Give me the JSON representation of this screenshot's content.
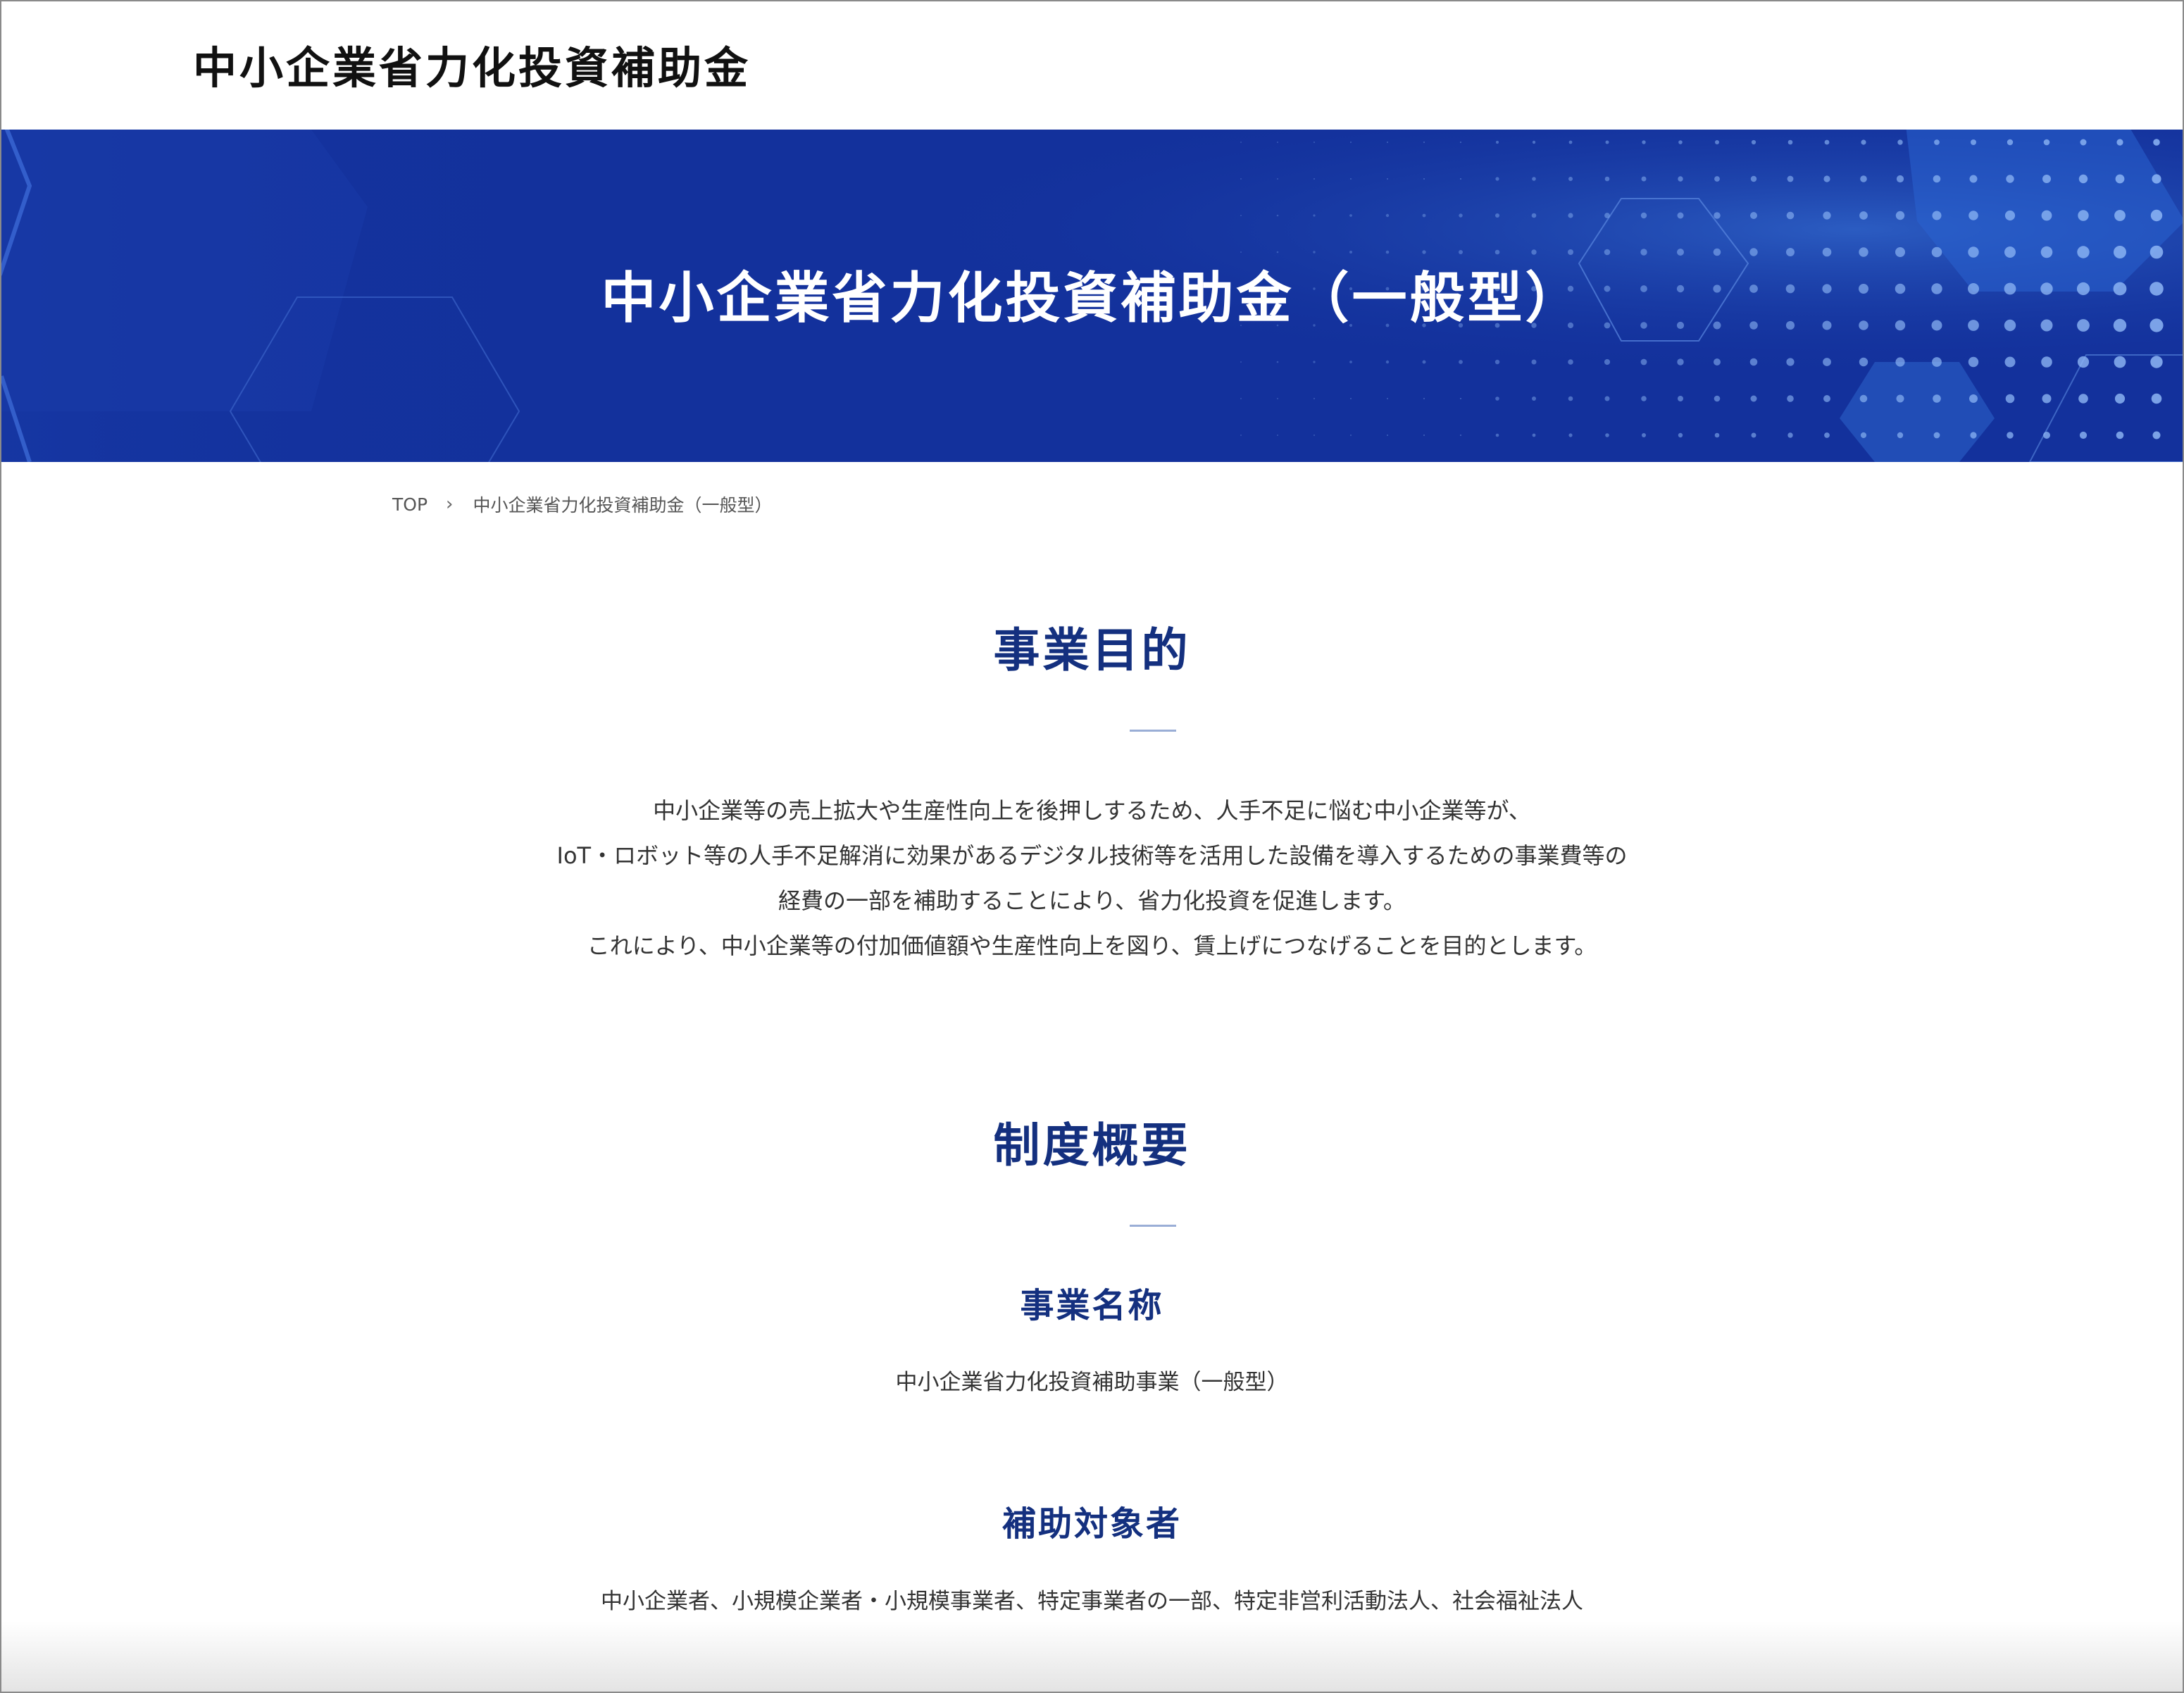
{
  "header": {
    "site_title": "中小企業省力化投資補助金"
  },
  "hero": {
    "title": "中小企業省力化投資補助金（一般型）"
  },
  "breadcrumb": {
    "home": "TOP",
    "separator": "›",
    "current": "中小企業省力化投資補助金（一般型）"
  },
  "purpose": {
    "title": "事業目的",
    "lines": [
      "中小企業等の売上拡大や生産性向上を後押しするため、人手不足に悩む中小企業等が、",
      "IoT・ロボット等の人手不足解消に効果があるデジタル技術等を活用した設備を導入するための事業費等の",
      "経費の一部を補助することにより、省力化投資を促進します。",
      "これにより、中小企業等の付加価値額や生産性向上を図り、賃上げにつなげることを目的とします。"
    ]
  },
  "overview": {
    "title": "制度概要",
    "items": [
      {
        "label": "事業名称",
        "value": "中小企業省力化投資補助事業（一般型）"
      },
      {
        "label": "補助対象者",
        "value": "中小企業者、小規模企業者・小規模事業者、特定事業者の一部、特定非営利活動法人、社会福祉法人"
      }
    ]
  },
  "colors": {
    "hero_background": "#13319c",
    "heading_navy": "#14307f",
    "accent_rule": "#9aaed6"
  }
}
